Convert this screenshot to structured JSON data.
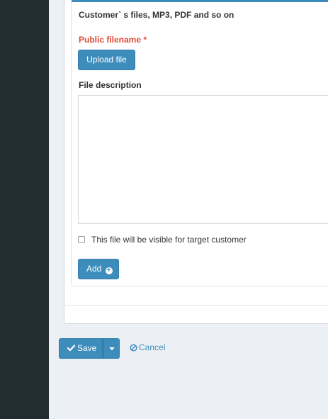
{
  "upload_form": {
    "title": "Customer` s files, MP3, PDF and so on",
    "public_filename_label": "Public filename *",
    "upload_button_label": "Upload file",
    "file_description_label": "File description",
    "file_description_value": "",
    "visibility_checkbox_label": "This file will be visible for target customer",
    "visibility_checked": false,
    "add_button_label": "Add"
  },
  "actions": {
    "save_label": "Save",
    "cancel_label": "Cancel"
  },
  "colors": {
    "primary": "#3c8dbc",
    "required_label": "#dd4b39",
    "sidebar": "#222d32",
    "page_background": "#ecf0f5"
  },
  "icons": {
    "add": "plus-circle-icon",
    "save": "check-icon",
    "dropdown": "caret-down-icon",
    "cancel": "ban-icon"
  }
}
